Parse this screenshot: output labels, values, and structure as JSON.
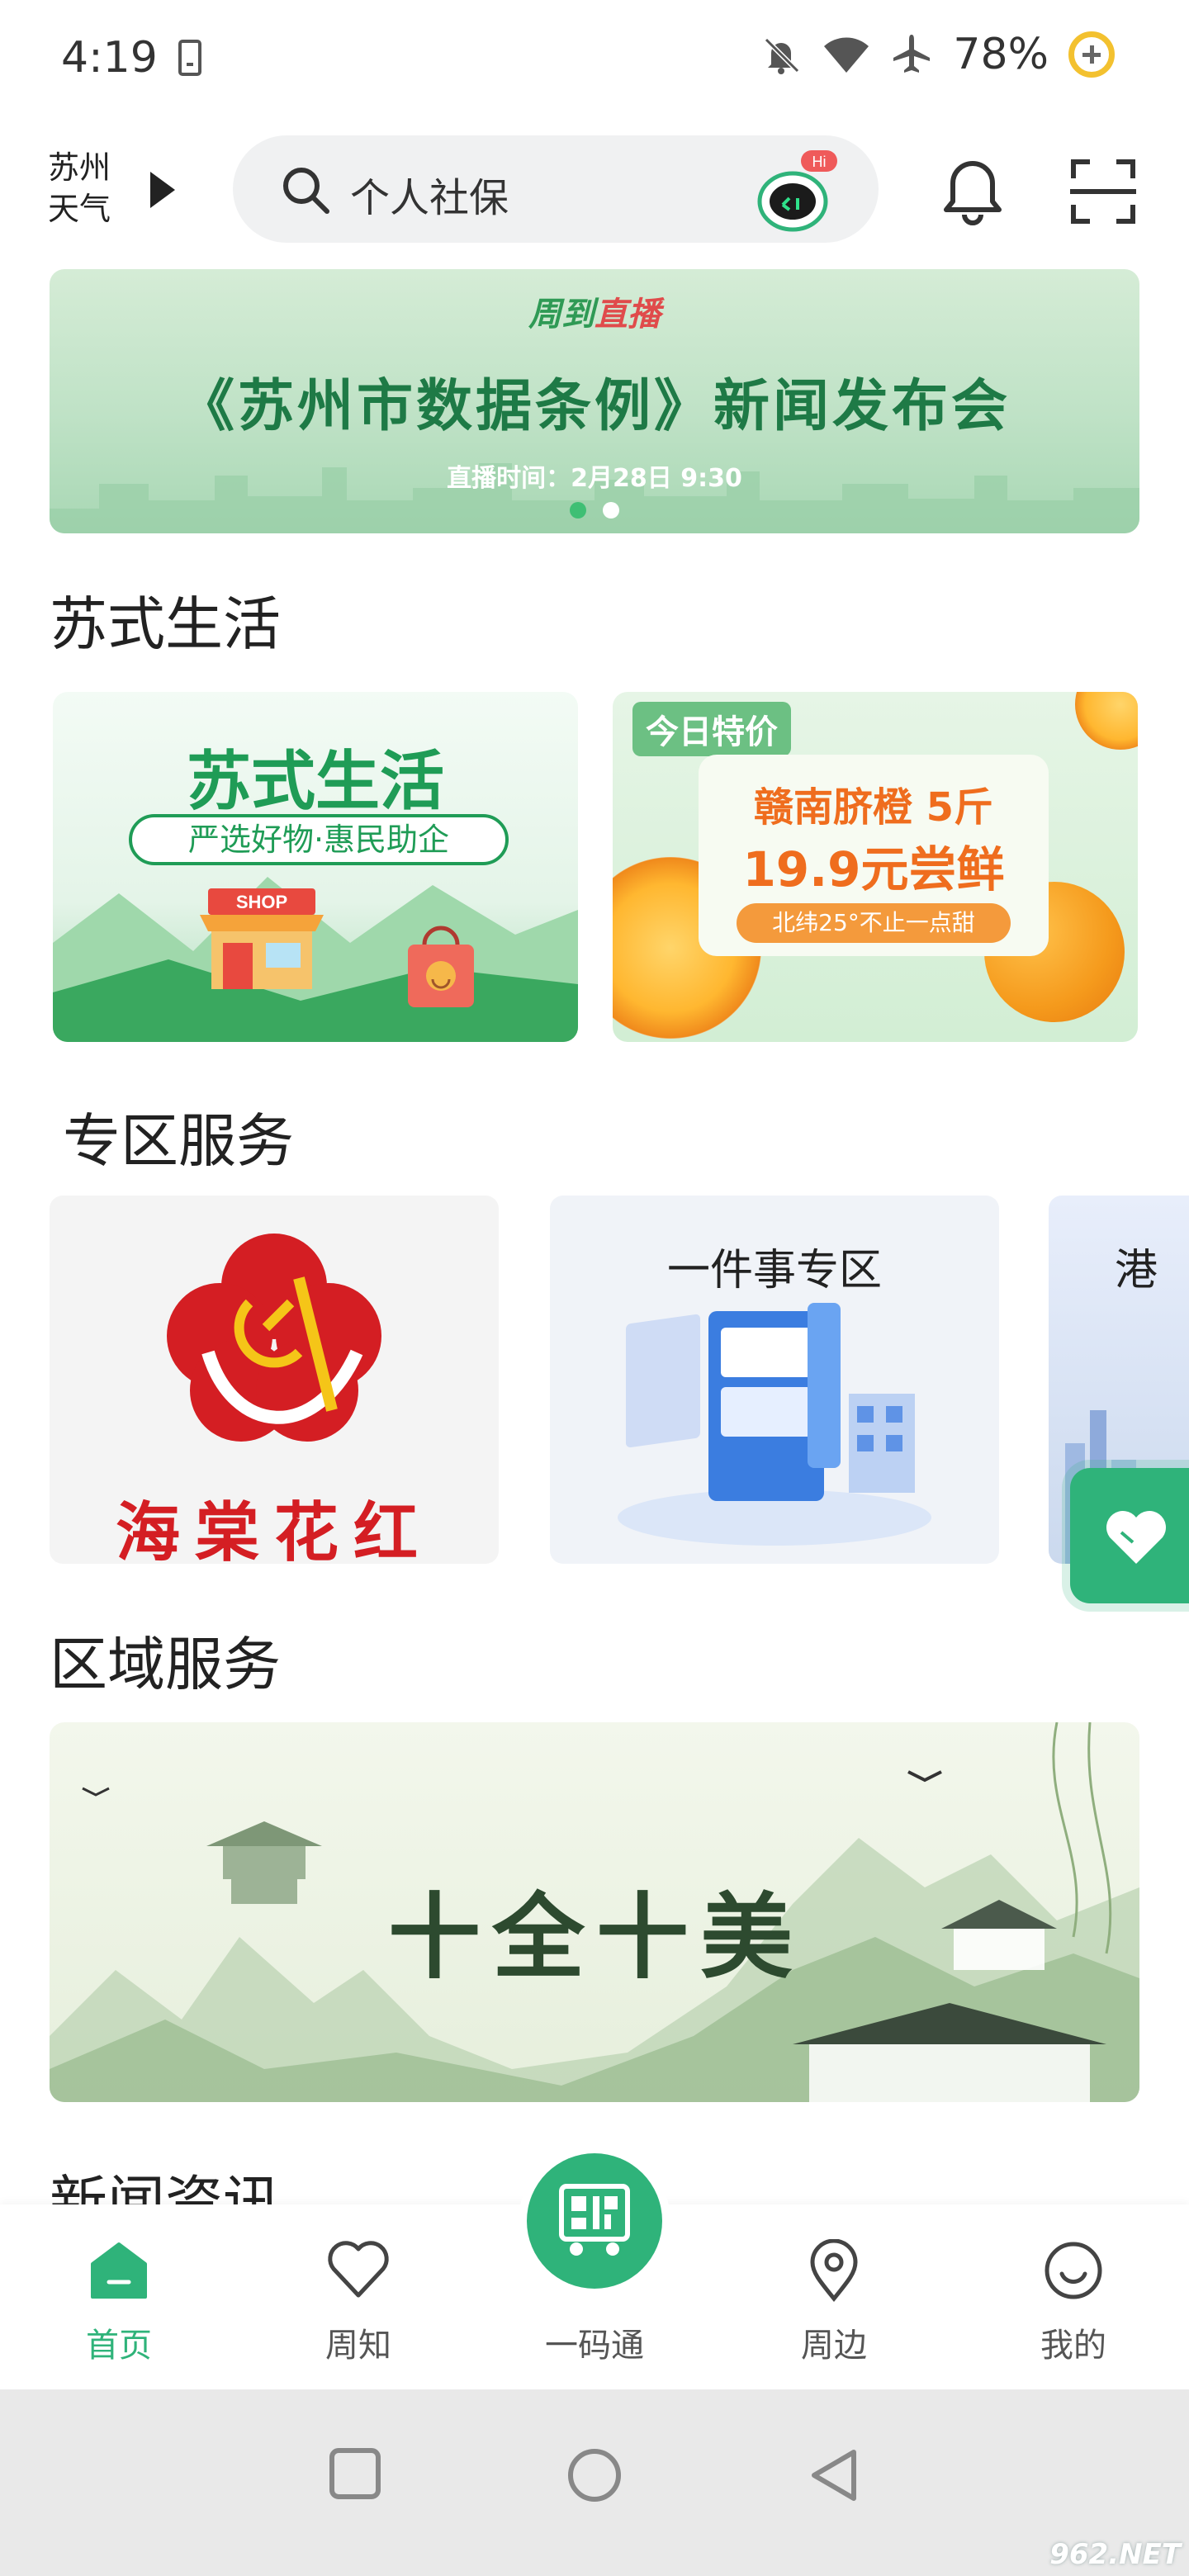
{
  "status_bar": {
    "time": "4:19",
    "battery": "78%",
    "icons": [
      "download-icon",
      "mute-icon",
      "wifi-icon",
      "airplane-icon",
      "battery-saver-icon"
    ]
  },
  "header": {
    "weather_line1": "苏州",
    "weather_line2": "天气",
    "search_placeholder": "个人社保",
    "mascot_badge": "Hi",
    "icons": [
      "search-icon",
      "mascot-icon",
      "bell-icon",
      "scan-icon"
    ]
  },
  "banner": {
    "logo_prefix": "周到",
    "logo_suffix": "直播",
    "title": "《苏州市数据条例》新闻发布会",
    "subtitle": "直播时间：2月28日 9:30",
    "active_dot": 0,
    "dot_count": 2
  },
  "sections": {
    "life": "苏式生活",
    "zone": "专区服务",
    "region": "区域服务",
    "news": "新闻资讯"
  },
  "life_cards": {
    "left_title": "苏式生活",
    "left_sub": "严选好物·惠民助企",
    "left_shop_sign": "SHOP",
    "right_tag": "今日特价",
    "right_line1": "赣南脐橙 5斤",
    "right_line2": "19.9元尝鲜",
    "right_line3": "北纬25°不止一点甜"
  },
  "zone_cards": {
    "card1_text": "海棠花红",
    "card2_title": "一件事专区",
    "card3_title": "港"
  },
  "region_banner": {
    "text": "十全十美"
  },
  "tabs": [
    {
      "label": "首页",
      "icon": "home-icon",
      "active": true
    },
    {
      "label": "周知",
      "icon": "heart-icon",
      "active": false
    },
    {
      "label": "一码通",
      "icon": "qr-code-icon",
      "active": false
    },
    {
      "label": "周边",
      "icon": "location-pin-icon",
      "active": false
    },
    {
      "label": "我的",
      "icon": "smiley-icon",
      "active": false
    }
  ],
  "nav": [
    "recents-button",
    "home-button",
    "back-button"
  ],
  "watermark": "962.NET",
  "colors": {
    "accent": "#2fb37a",
    "banner_title": "#1e7a46",
    "price_orange": "#ef6d1e",
    "party_red": "#d41e23"
  }
}
